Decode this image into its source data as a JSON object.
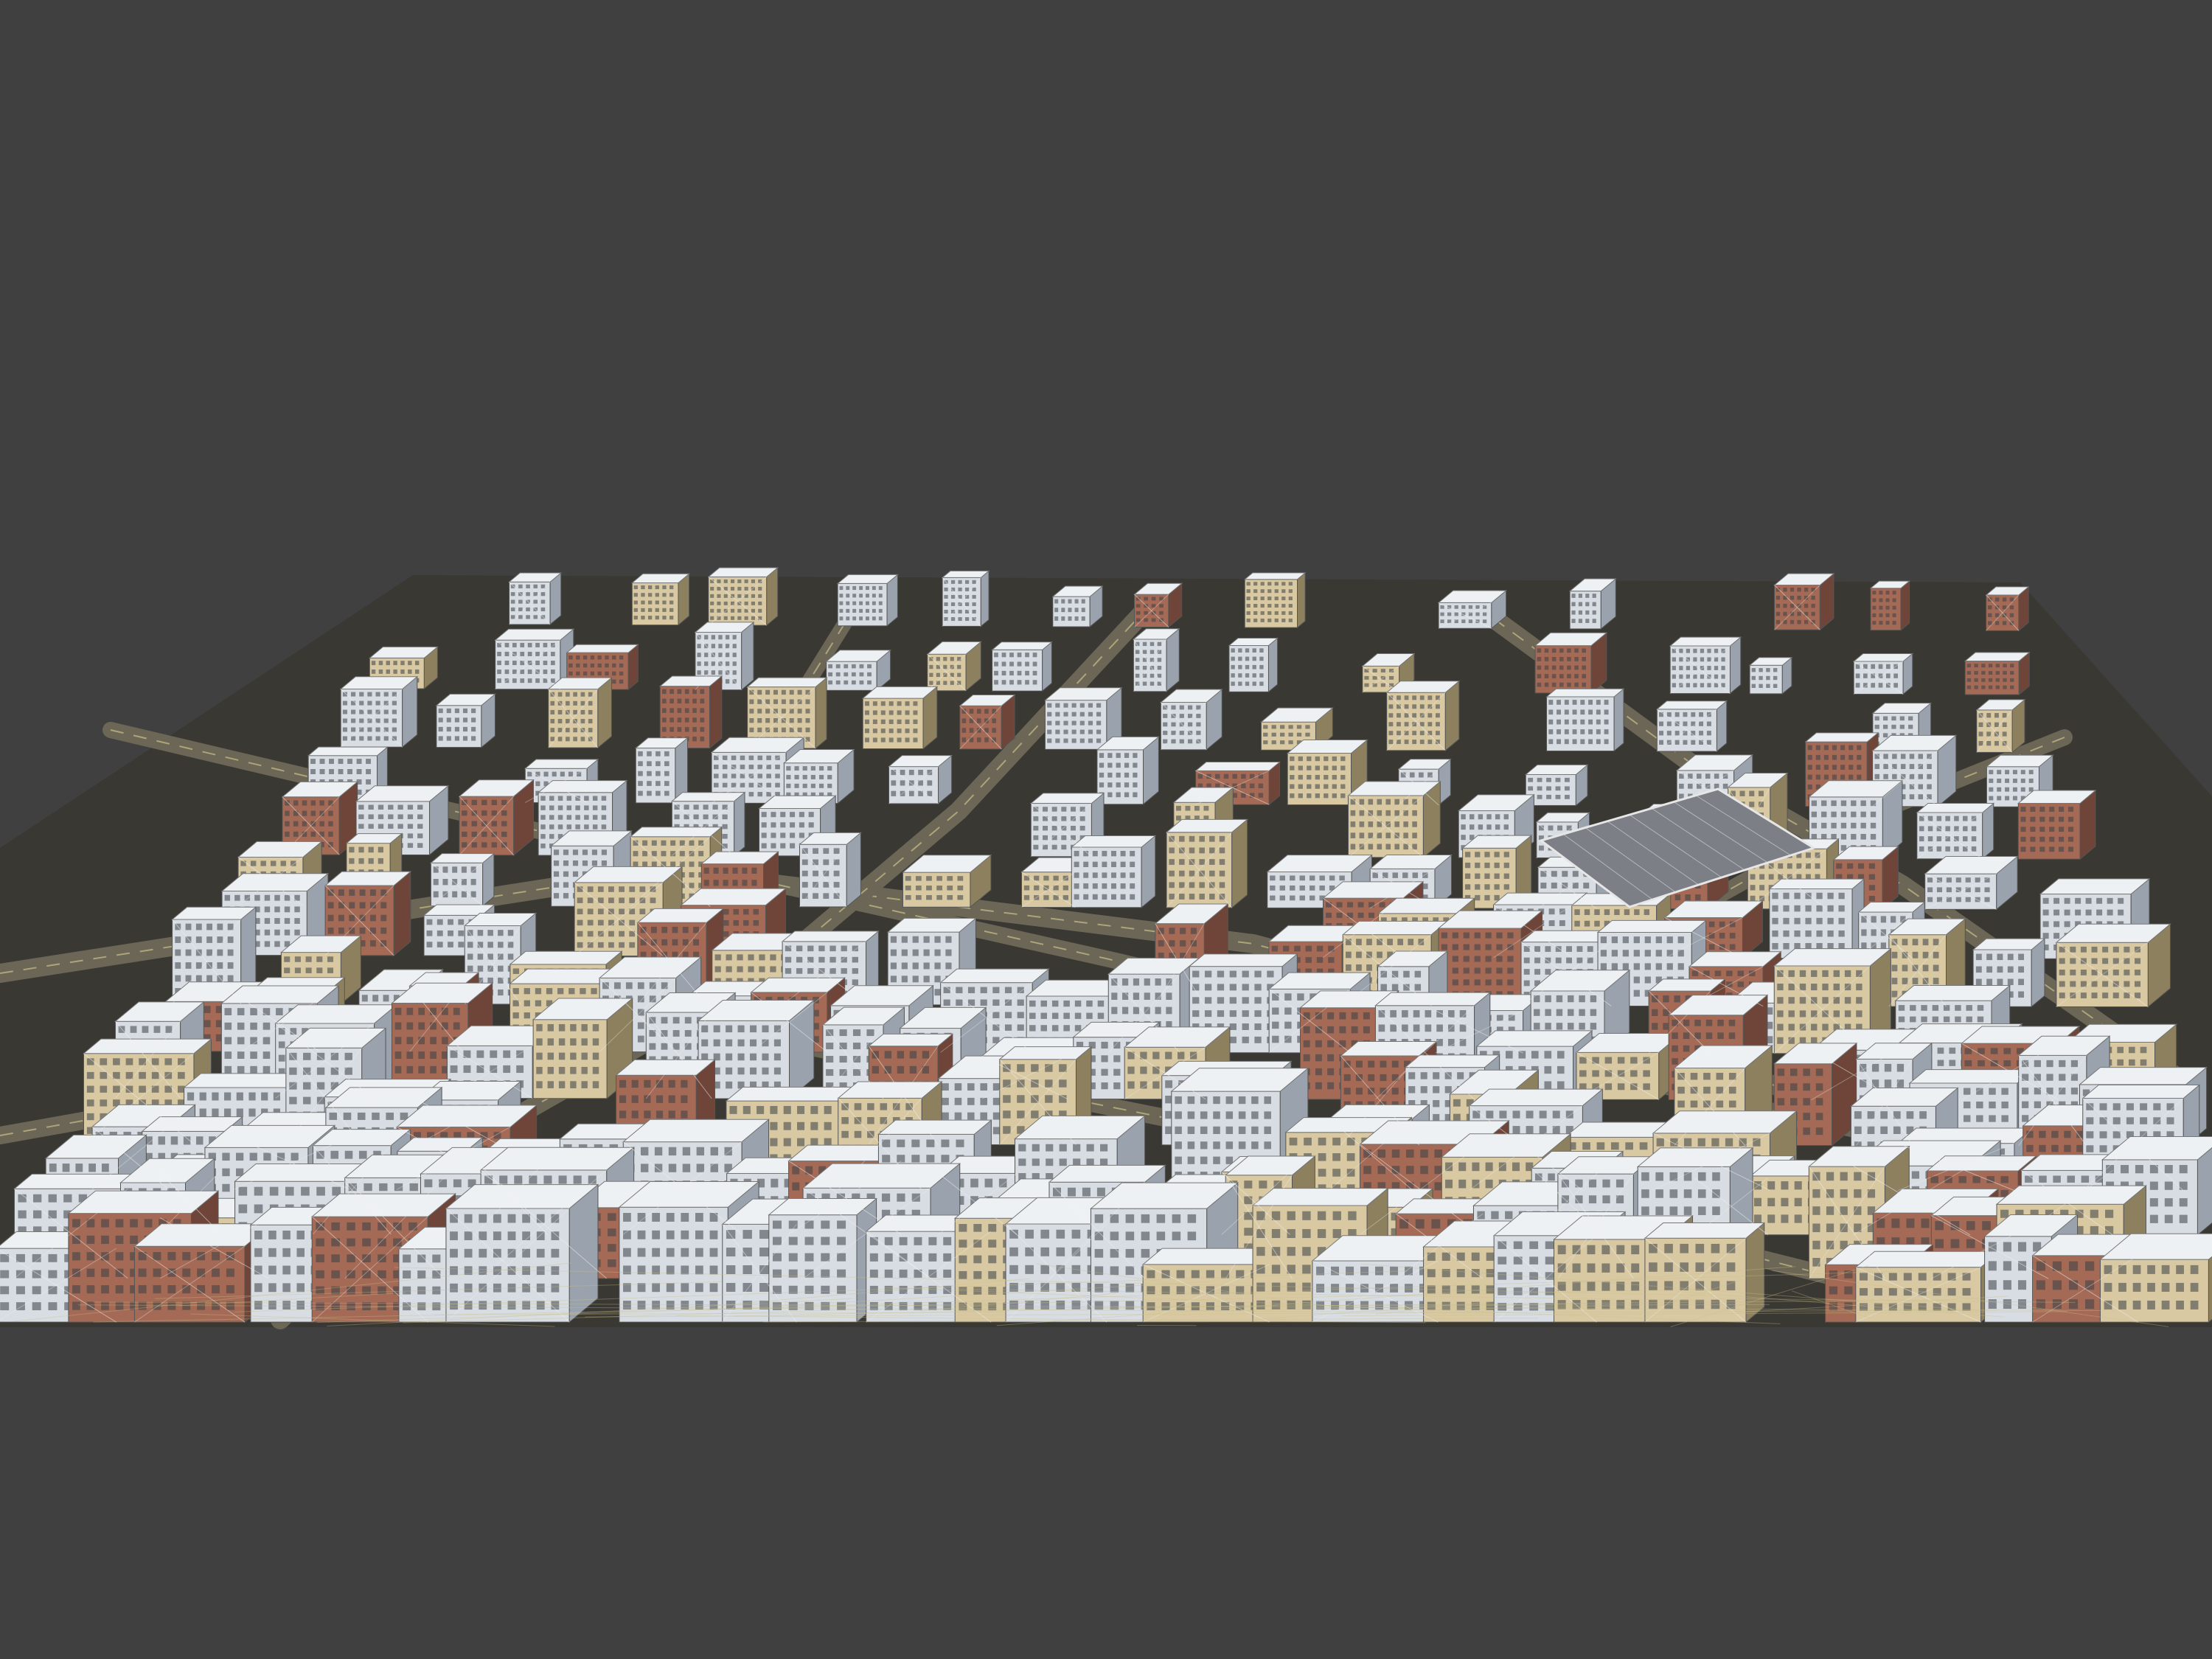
{
  "viewport": {
    "background_color": "#404040"
  },
  "scene": {
    "subject": "city-block-3d-model",
    "ground_color": "#3a3833",
    "road_color": "#6b6656",
    "road_line_color": "#c9c08a",
    "wire_color": "#f0f0f0",
    "building_palette": {
      "white": "#d8dde3",
      "white_shade": "#9aa3ad",
      "brick": "#a56a55",
      "brick_shade": "#6e4538",
      "cream": "#d9c9a2",
      "cream_shade": "#8d805f",
      "roof_light": "#eef1f4"
    }
  }
}
